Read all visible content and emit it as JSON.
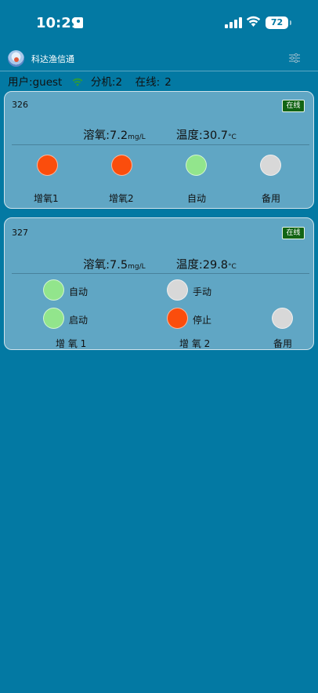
{
  "status_bar": {
    "time": "10:29",
    "battery": "72"
  },
  "app": {
    "title": "科达渔信通"
  },
  "summary": {
    "user_label": "用户: ",
    "user": "guest",
    "units_label": "分机: ",
    "units": "2",
    "online_label": "在线: ",
    "online": "2"
  },
  "colors": {
    "running": "#fb4d0c",
    "auto": "#92e58c",
    "idle": "#d8d8d8",
    "badge": "#126414",
    "background": "#0379a3"
  },
  "cards": [
    {
      "id": "326",
      "status": "在线",
      "oxygen_label": "溶氧:",
      "oxygen": "7.2",
      "oxygen_unit": "mg/L",
      "temp_label": "温度:",
      "temp": "30.7",
      "temp_unit": "°C",
      "devices": [
        {
          "label": "增氧1",
          "state": "running"
        },
        {
          "label": "增氧2",
          "state": "running"
        },
        {
          "label": "自动",
          "state": "auto"
        },
        {
          "label": "备用",
          "state": "idle"
        }
      ]
    },
    {
      "id": "327",
      "status": "在线",
      "oxygen_label": "溶氧:",
      "oxygen": "7.5",
      "oxygen_unit": "mg/L",
      "temp_label": "温度:",
      "temp": "29.8",
      "temp_unit": "°C",
      "aerator1": {
        "mode_label": "自动",
        "mode_state": "auto",
        "run_label": "启动",
        "run_state": "auto",
        "name": "增 氧 1"
      },
      "aerator2": {
        "mode_label": "手动",
        "mode_state": "idle",
        "run_label": "停止",
        "run_state": "running",
        "name": "增 氧 2"
      },
      "spare": {
        "label": "备用",
        "state": "idle"
      }
    }
  ]
}
